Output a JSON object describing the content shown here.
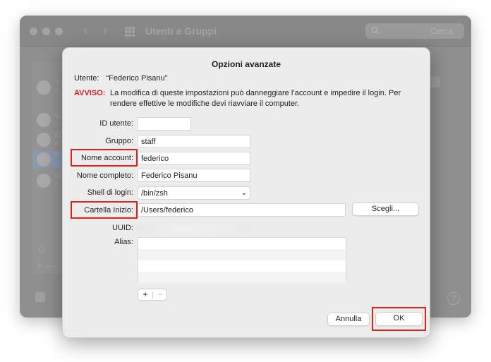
{
  "background_window": {
    "title": "Utenti e Gruppi",
    "search_placeholder": "Cerca",
    "sidebar_users": [
      {
        "initial": "T",
        "sub": "A"
      },
      {
        "initial": "C",
        "sub": "A"
      },
      {
        "initial": "D",
        "sub": "A"
      },
      {
        "initial": "F",
        "sub": "A"
      },
      {
        "initial": "U",
        "sub": "A"
      }
    ],
    "options_label": "O",
    "bottom_label": "F"
  },
  "dialog": {
    "title": "Opzioni avanzate",
    "user_label": "Utente:",
    "user_value": "“Federico Pisanu”",
    "warning_tag": "AVVISO:",
    "warning_text": "La modifica di queste impostazioni può danneggiare l’account e impedire il login. Per rendere effettive le modifiche devi riavviare il computer.",
    "fields": {
      "user_id": {
        "label": "ID utente:",
        "value": ""
      },
      "group": {
        "label": "Gruppo:",
        "value": "staff"
      },
      "account_name": {
        "label": "Nome account:",
        "value": "federico"
      },
      "full_name": {
        "label": "Nome completo:",
        "value": "Federico Pisanu"
      },
      "login_shell": {
        "label": "Shell di login:",
        "value": "/bin/zsh"
      },
      "home_folder": {
        "label": "Cartella Inizio:",
        "value": "/Users/federico"
      },
      "uuid": {
        "label": "UUID:",
        "value": ""
      },
      "alias": {
        "label": "Alias:"
      }
    },
    "choose_button": "Scegli...",
    "add_symbol": "+",
    "remove_symbol": "−",
    "cancel_button": "Annulla",
    "ok_button": "OK"
  },
  "colors": {
    "highlight": "#e0221d",
    "warning": "#d11f1f",
    "dialog_bg": "#ececec"
  }
}
